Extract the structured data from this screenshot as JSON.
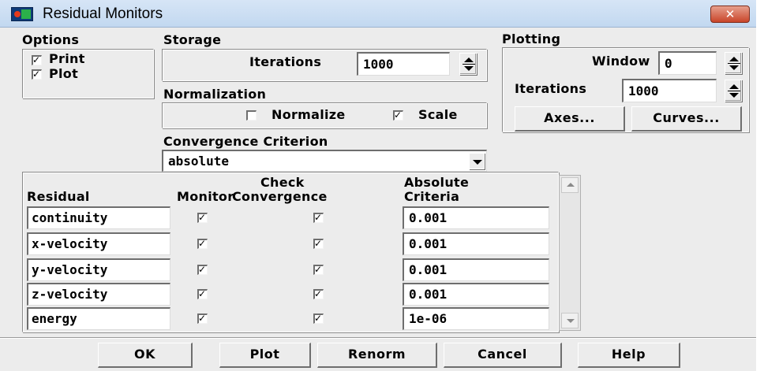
{
  "window": {
    "title": "Residual Monitors",
    "close_glyph": "✕"
  },
  "options": {
    "heading": "Options",
    "print": {
      "label": "Print",
      "checked": true
    },
    "plot": {
      "label": "Plot",
      "checked": true
    }
  },
  "storage": {
    "heading": "Storage",
    "iterations_label": "Iterations",
    "iterations_value": "1000"
  },
  "normalization": {
    "heading": "Normalization",
    "normalize": {
      "label": "Normalize",
      "checked": false
    },
    "scale": {
      "label": "Scale",
      "checked": true
    }
  },
  "convergence": {
    "heading": "Convergence Criterion",
    "selected": "absolute"
  },
  "plotting": {
    "heading": "Plotting",
    "window_label": "Window",
    "window_value": "0",
    "iterations_label": "Iterations",
    "iterations_value": "1000",
    "axes_button": "Axes...",
    "curves_button": "Curves..."
  },
  "table": {
    "headers": {
      "residual": "Residual",
      "monitor": "Monitor",
      "check_top": "Check",
      "check_bottom": "Convergence",
      "abs_top": "Absolute",
      "abs_bottom": "Criteria"
    },
    "rows": [
      {
        "name": "continuity",
        "monitor": true,
        "check": true,
        "criteria": "0.001"
      },
      {
        "name": "x-velocity",
        "monitor": true,
        "check": true,
        "criteria": "0.001"
      },
      {
        "name": "y-velocity",
        "monitor": true,
        "check": true,
        "criteria": "0.001"
      },
      {
        "name": "z-velocity",
        "monitor": true,
        "check": true,
        "criteria": "0.001"
      },
      {
        "name": "energy",
        "monitor": true,
        "check": true,
        "criteria": "1e-06"
      }
    ]
  },
  "buttons": {
    "ok": "OK",
    "plot": "Plot",
    "renorm": "Renorm",
    "cancel": "Cancel",
    "help": "Help"
  }
}
